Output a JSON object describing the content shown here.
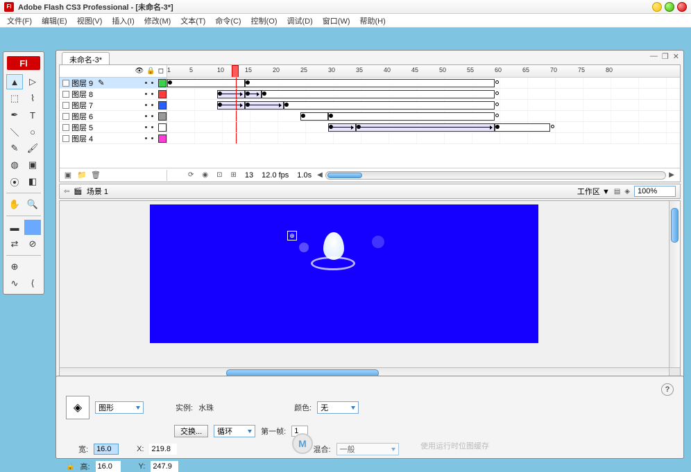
{
  "app": {
    "title": "Adobe Flash CS3 Professional - [未命名-3*]",
    "brand": "Fl"
  },
  "menu": {
    "file": "文件(F)",
    "edit": "编辑(E)",
    "view": "视图(V)",
    "insert": "插入(I)",
    "modify": "修改(M)",
    "text": "文本(T)",
    "commands": "命令(C)",
    "control": "控制(O)",
    "debug": "调试(D)",
    "window": "窗口(W)",
    "help": "帮助(H)"
  },
  "doc": {
    "tab": "未命名-3*"
  },
  "timeline": {
    "ruler": [
      "1",
      "5",
      "10",
      "15",
      "20",
      "25",
      "30",
      "35",
      "40",
      "45",
      "50",
      "55",
      "60",
      "65",
      "70",
      "75",
      "80"
    ],
    "playhead_frame": 13,
    "fps": "12.0 fps",
    "elapsed": "1.0s",
    "current_frame": "13",
    "layers": [
      {
        "name": "图层 9",
        "color": "#39d24a",
        "selected": true,
        "spans": [
          {
            "s": 1,
            "e": 15,
            "tween": false
          },
          {
            "s": 15,
            "e": 60,
            "tween": false
          }
        ]
      },
      {
        "name": "图层 8",
        "color": "#ff3b3b",
        "selected": false,
        "spans": [
          {
            "s": 10,
            "e": 15,
            "tween": true
          },
          {
            "s": 15,
            "e": 18,
            "tween": true
          },
          {
            "s": 18,
            "e": 60,
            "tween": false
          }
        ]
      },
      {
        "name": "图层 7",
        "color": "#2a5fff",
        "selected": false,
        "spans": [
          {
            "s": 10,
            "e": 15,
            "tween": true
          },
          {
            "s": 15,
            "e": 22,
            "tween": true
          },
          {
            "s": 22,
            "e": 60,
            "tween": false
          }
        ]
      },
      {
        "name": "图层 6",
        "color": "#9a9a9a",
        "selected": false,
        "spans": [
          {
            "s": 25,
            "e": 30,
            "tween": false
          },
          {
            "s": 30,
            "e": 60,
            "tween": false
          }
        ]
      },
      {
        "name": "图层 5",
        "color": "#ffffff",
        "selected": false,
        "spans": [
          {
            "s": 30,
            "e": 35,
            "tween": true
          },
          {
            "s": 35,
            "e": 60,
            "tween": true
          },
          {
            "s": 60,
            "e": 70,
            "tween": false
          }
        ]
      },
      {
        "name": "图层 4",
        "color": "#ff3bd8",
        "selected": false,
        "spans": []
      }
    ]
  },
  "scene": {
    "name": "场景 1",
    "workspace_label": "工作区 ▼",
    "zoom": "100%"
  },
  "props": {
    "type": "图形",
    "instance_lbl": "实例:",
    "instance_val": "水珠",
    "color_lbl": "颜色:",
    "color_val": "无",
    "swap_btn": "交换...",
    "loop_val": "循环",
    "firstframe_lbl": "第一帧:",
    "firstframe_val": "1",
    "blend_lbl": "混合:",
    "blend_val": "一般",
    "w_lbl": "宽:",
    "w_val": "16.0",
    "h_lbl": "高:",
    "h_val": "16.0",
    "x_lbl": "X:",
    "x_val": "219.8",
    "y_lbl": "Y:",
    "y_val": "247.9"
  },
  "watermark": "使用运行时位图缓存"
}
